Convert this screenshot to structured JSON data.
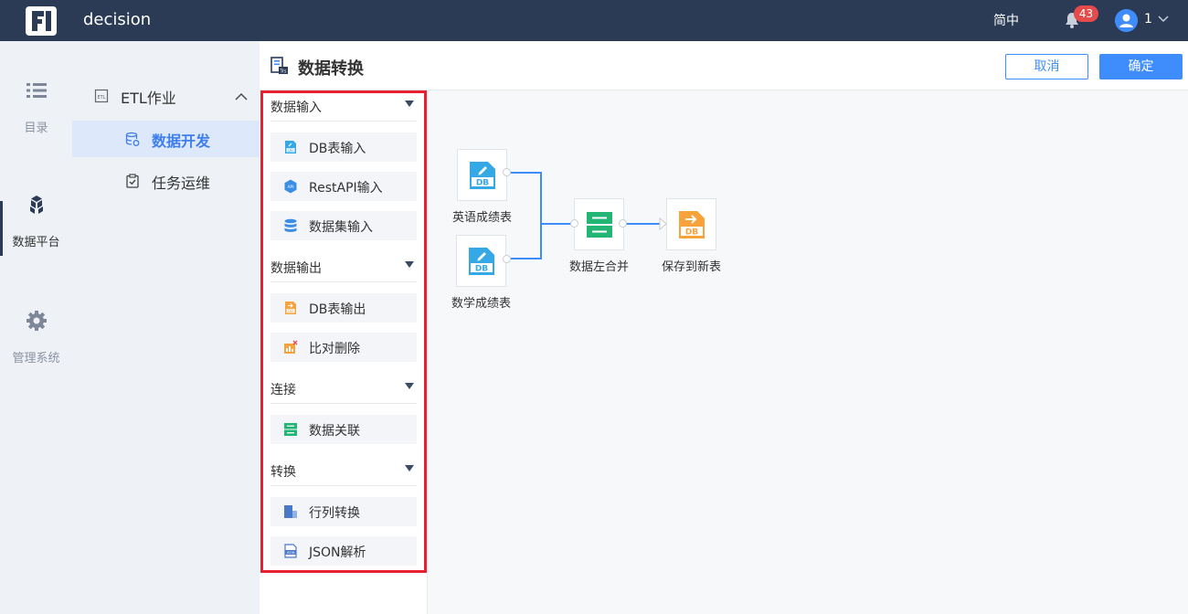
{
  "topbar": {
    "app_name": "decision",
    "lang": "简中",
    "notification_count": "43",
    "user": "1"
  },
  "rail": {
    "items": [
      {
        "label": "目录",
        "icon": "list-icon"
      },
      {
        "label": "数据平台",
        "icon": "cubes-icon"
      },
      {
        "label": "管理系统",
        "icon": "gear-icon"
      }
    ]
  },
  "nav": {
    "group_label": "ETL作业",
    "items": [
      {
        "label": "数据开发",
        "icon": "database-icon"
      },
      {
        "label": "任务运维",
        "icon": "clipboard-check-icon"
      }
    ]
  },
  "header": {
    "title": "数据转换",
    "cancel_label": "取消",
    "ok_label": "确定"
  },
  "panel": {
    "sections": [
      {
        "title": "数据输入",
        "items": [
          "DB表输入",
          "RestAPI输入",
          "数据集输入"
        ]
      },
      {
        "title": "数据输出",
        "items": [
          "DB表输出",
          "比对删除"
        ]
      },
      {
        "title": "连接",
        "items": [
          "数据关联"
        ]
      },
      {
        "title": "转换",
        "items": [
          "行列转换",
          "JSON解析"
        ]
      }
    ]
  },
  "flow": {
    "nodes": [
      {
        "label": "英语成绩表",
        "icon": "db-input-icon"
      },
      {
        "label": "数学成绩表",
        "icon": "db-input-icon"
      },
      {
        "label": "数据左合并",
        "icon": "data-join-icon"
      },
      {
        "label": "保存到新表",
        "icon": "db-output-icon"
      }
    ]
  },
  "colors": {
    "topbar": "#2b3a55",
    "accent": "#3f8dfc",
    "highlight_border": "#e8202f",
    "badge": "#e64b4b"
  }
}
